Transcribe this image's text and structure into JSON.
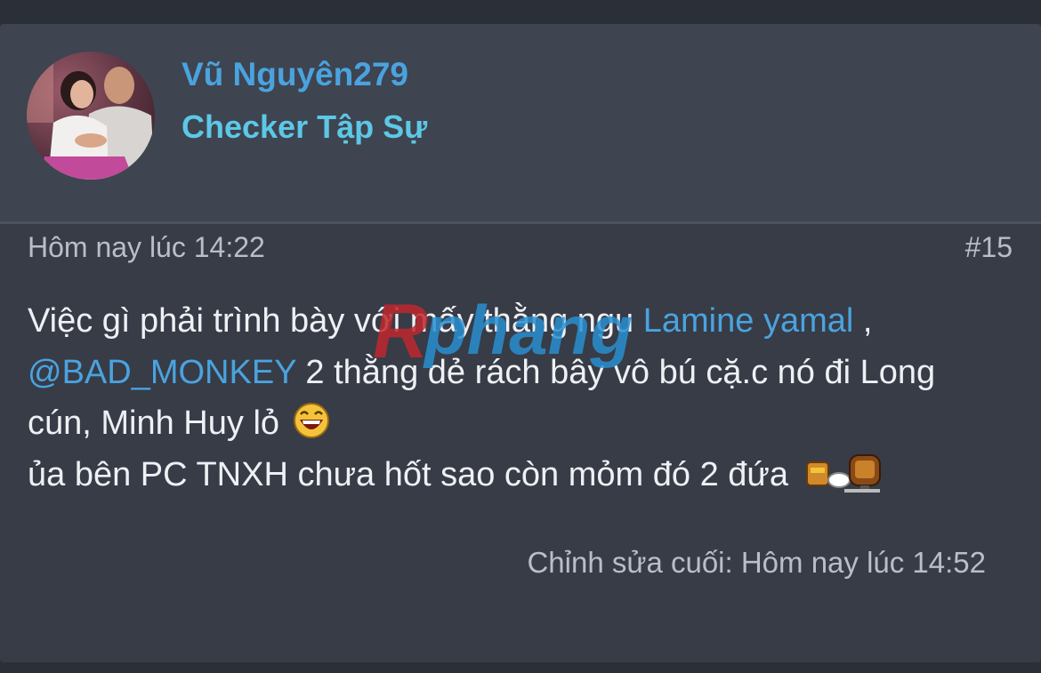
{
  "post": {
    "author": {
      "username": "Vũ Nguyên279",
      "title": "Checker Tập Sự"
    },
    "timestamp": "Hôm nay lúc 14:22",
    "post_number": "#15",
    "lines": {
      "l1_text": "Việc gì phải trình bày với mấy thằng ngu ",
      "l1_mention": "Lamine yamal",
      "l1_tail": " ,",
      "l2_mention": "@BAD_MONKEY",
      "l2_text": " 2 thằng dẻ rách bây vô bú cặ.c nó đi Long",
      "l3_text": "cún, Minh Huy lỏ ",
      "l4_text": "ủa bên PC TNXH chưa hốt sao còn mỏm đó 2 đứa "
    },
    "edited": "Chỉnh sửa cuối: Hôm nay lúc 14:52",
    "emojis": [
      "laughing-smiley-icon",
      "coffee-break-icon"
    ]
  },
  "watermark": {
    "text": "Rphang"
  },
  "colors": {
    "background": "#2b2f37",
    "card": "#373c47",
    "header": "#3e4450",
    "username": "#4aa3df",
    "user_title": "#5cc8e6",
    "mention": "#4aa3df",
    "body_text": "#eef0f4",
    "meta_text": "#b9bec8"
  }
}
